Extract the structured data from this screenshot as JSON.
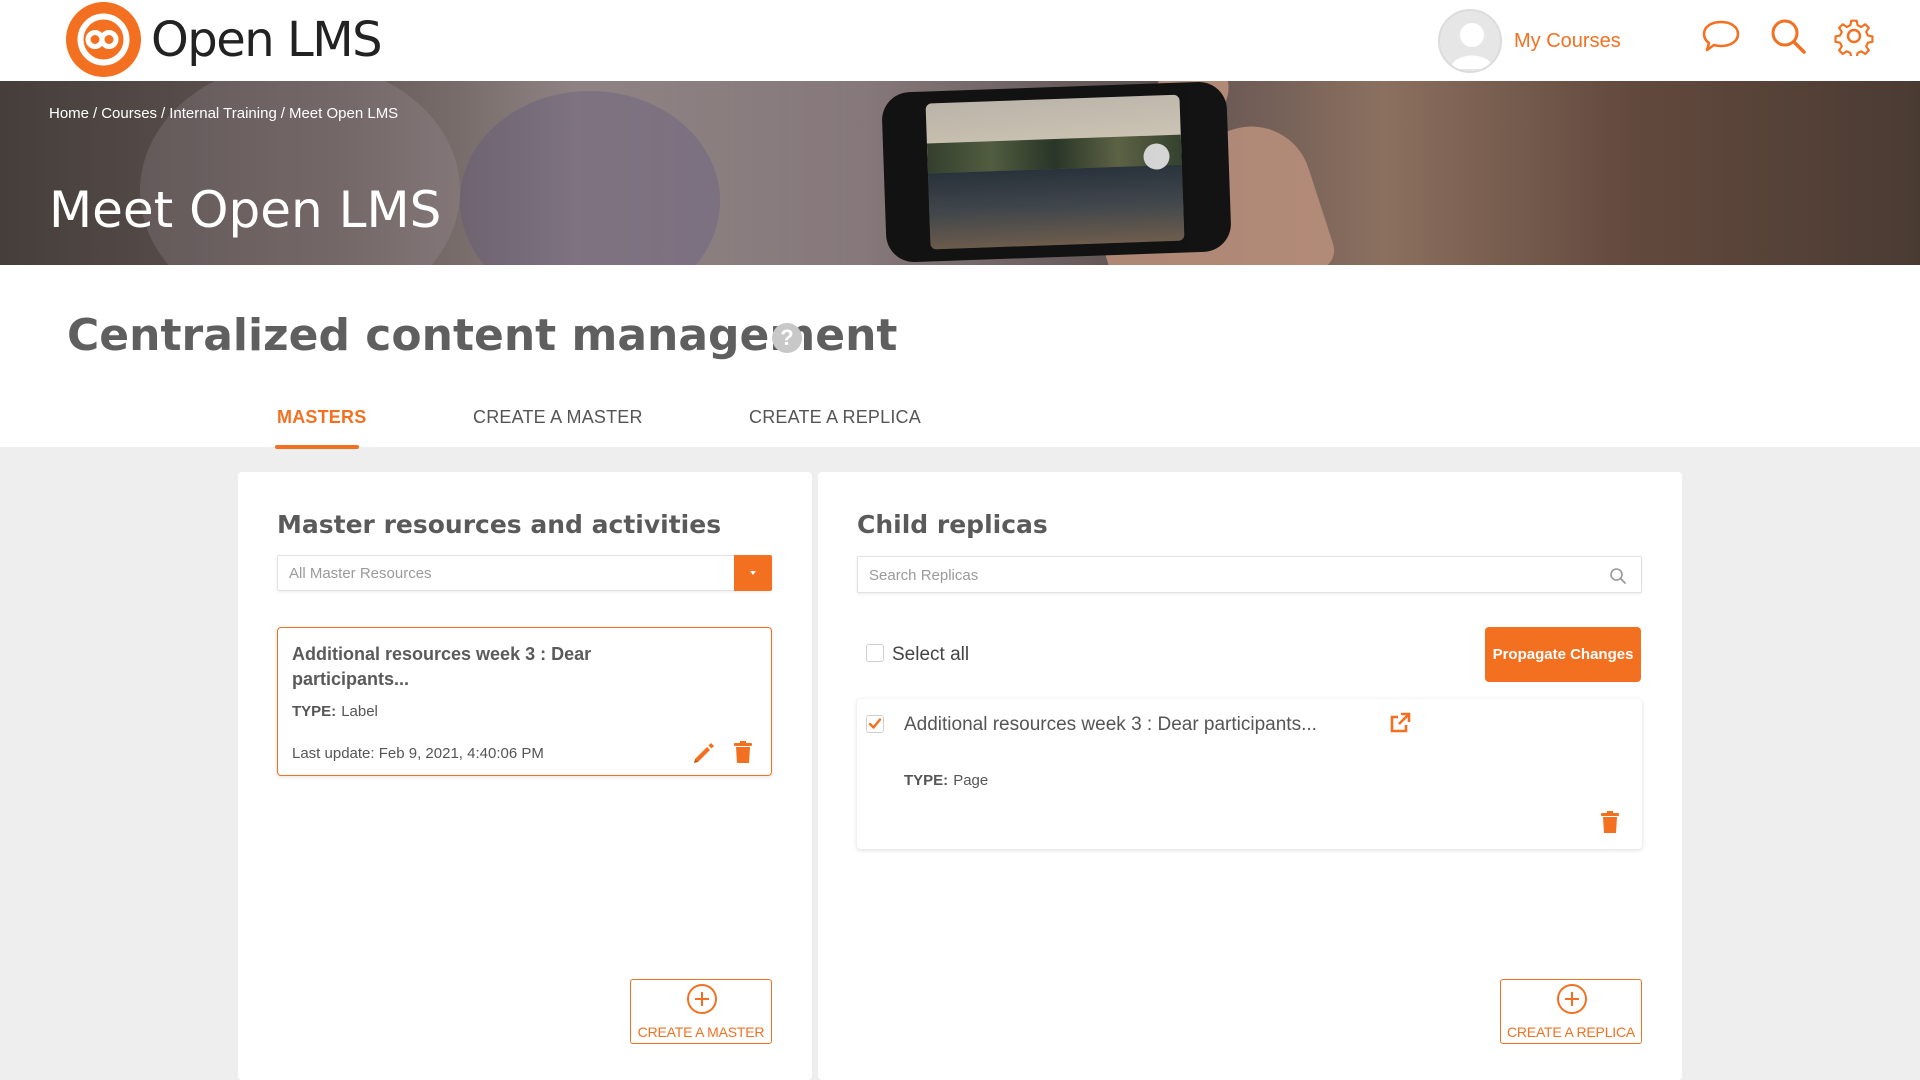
{
  "header": {
    "logo_text": "Open LMS",
    "user_link": "My Courses",
    "icons": [
      "chat-icon",
      "search-icon",
      "gear-icon"
    ]
  },
  "banner": {
    "breadcrumb": [
      "Home",
      "Courses",
      "Internal Training",
      "Meet Open LMS"
    ],
    "separator": "/",
    "title": "Meet Open LMS"
  },
  "section": {
    "title": "Centralized content management",
    "help": "?",
    "tabs": [
      {
        "label": "MASTERS",
        "active": true
      },
      {
        "label": "CREATE A MASTER",
        "active": false
      },
      {
        "label": "CREATE A REPLICA",
        "active": false
      }
    ]
  },
  "masters_panel": {
    "title": "Master resources and activities",
    "filter_placeholder": "All Master Resources",
    "card": {
      "title": "Additional resources week 3 : Dear participants...",
      "type_label": "TYPE:",
      "type_value": "Label",
      "last_update": "Last update: Feb 9, 2021, 4:40:06 PM"
    },
    "create_label": "CREATE A MASTER"
  },
  "replicas_panel": {
    "title": "Child replicas",
    "search_placeholder": "Search Replicas",
    "select_all": "Select all",
    "propagate": "Propagate Changes",
    "card": {
      "checked": true,
      "title": "Additional resources week 3 : Dear participants...",
      "type_label": "TYPE:",
      "type_value": "Page"
    },
    "create_label": "CREATE A REPLICA"
  },
  "colors": {
    "accent": "#f37021",
    "background": "#eeeeee",
    "panel": "#ffffff"
  }
}
